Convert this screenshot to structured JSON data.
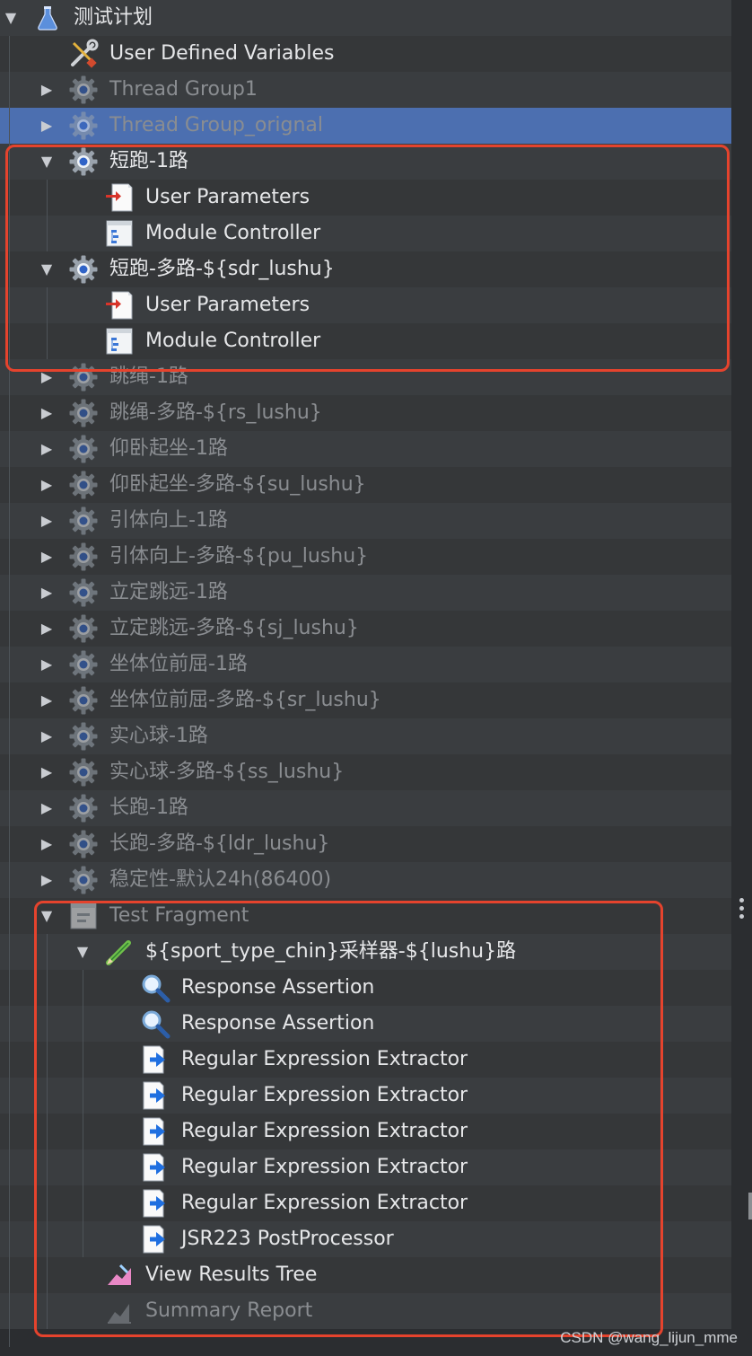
{
  "colors": {
    "background": "#2b2d30",
    "row_background": "#3a3d40",
    "selection": "#4c6fb0",
    "highlight_box": "#e5432d",
    "text_enabled": "#e6e7e9",
    "text_disabled": "#8a8d91"
  },
  "tree": [
    {
      "label": "测试计划",
      "icon": "flask-icon",
      "depth": 0,
      "expander": "expanded",
      "disabled": false
    },
    {
      "label": "User Defined Variables",
      "icon": "wrench-screwdriver-icon",
      "depth": 1,
      "expander": "none",
      "disabled": false
    },
    {
      "label": "Thread Group1",
      "icon": "gear-icon",
      "depth": 1,
      "expander": "collapsed",
      "disabled": true
    },
    {
      "label": "Thread Group_orignal",
      "icon": "gear-icon",
      "depth": 1,
      "expander": "collapsed",
      "disabled": true,
      "selected": true
    },
    {
      "label": "短跑-1路",
      "icon": "gear-icon",
      "depth": 1,
      "expander": "expanded",
      "disabled": false
    },
    {
      "label": "User Parameters",
      "icon": "user-parameters-icon",
      "depth": 2,
      "expander": "none",
      "disabled": false
    },
    {
      "label": "Module Controller",
      "icon": "module-controller-icon",
      "depth": 2,
      "expander": "none",
      "disabled": false
    },
    {
      "label": "短跑-多路-${sdr_lushu}",
      "icon": "gear-icon",
      "depth": 1,
      "expander": "expanded",
      "disabled": false
    },
    {
      "label": "User Parameters",
      "icon": "user-parameters-icon",
      "depth": 2,
      "expander": "none",
      "disabled": false
    },
    {
      "label": "Module Controller",
      "icon": "module-controller-icon",
      "depth": 2,
      "expander": "none",
      "disabled": false
    },
    {
      "label": "跳绳-1路",
      "icon": "gear-icon",
      "depth": 1,
      "expander": "collapsed",
      "disabled": true
    },
    {
      "label": "跳绳-多路-${rs_lushu}",
      "icon": "gear-icon",
      "depth": 1,
      "expander": "collapsed",
      "disabled": true
    },
    {
      "label": "仰卧起坐-1路",
      "icon": "gear-icon",
      "depth": 1,
      "expander": "collapsed",
      "disabled": true
    },
    {
      "label": "仰卧起坐-多路-${su_lushu}",
      "icon": "gear-icon",
      "depth": 1,
      "expander": "collapsed",
      "disabled": true
    },
    {
      "label": "引体向上-1路",
      "icon": "gear-icon",
      "depth": 1,
      "expander": "collapsed",
      "disabled": true
    },
    {
      "label": "引体向上-多路-${pu_lushu}",
      "icon": "gear-icon",
      "depth": 1,
      "expander": "collapsed",
      "disabled": true
    },
    {
      "label": "立定跳远-1路",
      "icon": "gear-icon",
      "depth": 1,
      "expander": "collapsed",
      "disabled": true
    },
    {
      "label": "立定跳远-多路-${sj_lushu}",
      "icon": "gear-icon",
      "depth": 1,
      "expander": "collapsed",
      "disabled": true
    },
    {
      "label": "坐体位前屈-1路",
      "icon": "gear-icon",
      "depth": 1,
      "expander": "collapsed",
      "disabled": true
    },
    {
      "label": "坐体位前屈-多路-${sr_lushu}",
      "icon": "gear-icon",
      "depth": 1,
      "expander": "collapsed",
      "disabled": true
    },
    {
      "label": "实心球-1路",
      "icon": "gear-icon",
      "depth": 1,
      "expander": "collapsed",
      "disabled": true
    },
    {
      "label": "实心球-多路-${ss_lushu}",
      "icon": "gear-icon",
      "depth": 1,
      "expander": "collapsed",
      "disabled": true
    },
    {
      "label": "长跑-1路",
      "icon": "gear-icon",
      "depth": 1,
      "expander": "collapsed",
      "disabled": true
    },
    {
      "label": "长跑-多路-${ldr_lushu}",
      "icon": "gear-icon",
      "depth": 1,
      "expander": "collapsed",
      "disabled": true
    },
    {
      "label": "稳定性-默认24h(86400)",
      "icon": "gear-icon",
      "depth": 1,
      "expander": "collapsed",
      "disabled": true
    },
    {
      "label": "Test Fragment",
      "icon": "test-fragment-icon",
      "depth": 1,
      "expander": "expanded",
      "disabled": true
    },
    {
      "label": "${sport_type_chin}采样器-${lushu}路",
      "icon": "sampler-pen-icon",
      "depth": 2,
      "expander": "expanded",
      "disabled": false
    },
    {
      "label": "Response Assertion",
      "icon": "magnifier-icon",
      "depth": 3,
      "expander": "none",
      "disabled": false
    },
    {
      "label": "Response Assertion",
      "icon": "magnifier-icon",
      "depth": 3,
      "expander": "none",
      "disabled": false
    },
    {
      "label": "Regular Expression Extractor",
      "icon": "extractor-icon",
      "depth": 3,
      "expander": "none",
      "disabled": false
    },
    {
      "label": "Regular Expression Extractor",
      "icon": "extractor-icon",
      "depth": 3,
      "expander": "none",
      "disabled": false
    },
    {
      "label": "Regular Expression Extractor",
      "icon": "extractor-icon",
      "depth": 3,
      "expander": "none",
      "disabled": false
    },
    {
      "label": "Regular Expression Extractor",
      "icon": "extractor-icon",
      "depth": 3,
      "expander": "none",
      "disabled": false
    },
    {
      "label": "Regular Expression Extractor",
      "icon": "extractor-icon",
      "depth": 3,
      "expander": "none",
      "disabled": false
    },
    {
      "label": "JSR223 PostProcessor",
      "icon": "extractor-icon",
      "depth": 3,
      "expander": "none",
      "disabled": false
    },
    {
      "label": "View Results Tree",
      "icon": "results-tree-icon",
      "depth": 2,
      "expander": "none",
      "disabled": false
    },
    {
      "label": "Summary Report",
      "icon": "summary-report-icon",
      "depth": 2,
      "expander": "none",
      "disabled": true
    }
  ],
  "watermark": "CSDN @wang_lijun_mme"
}
